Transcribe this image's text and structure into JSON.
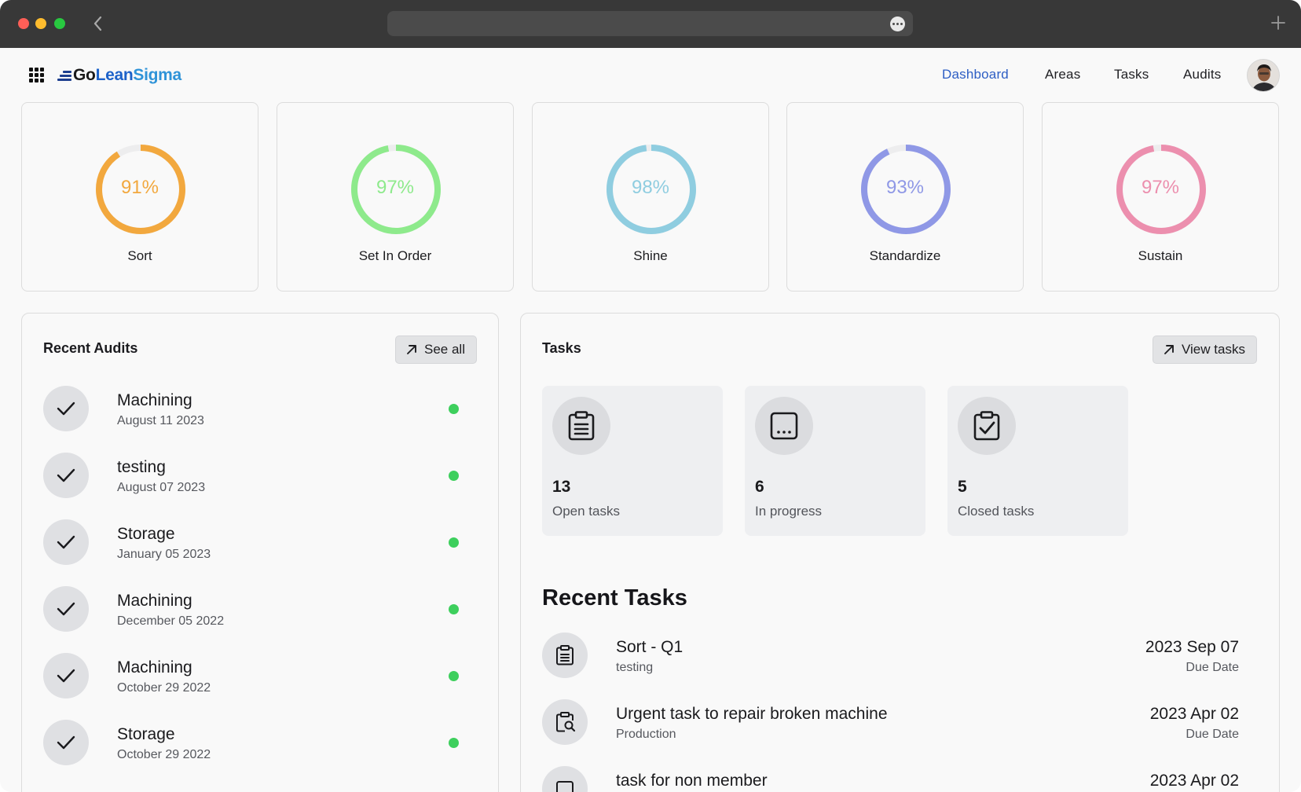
{
  "window": {
    "controls": [
      "close",
      "minimize",
      "zoom"
    ],
    "back_icon": "chevron-left-icon",
    "url_more_icon": "ellipsis-icon",
    "new_tab_icon": "plus-icon"
  },
  "header": {
    "app_grid_icon": "apps-grid-icon",
    "logo": {
      "go": "Go",
      "lean": "Lean",
      "sigma": "Sigma"
    },
    "nav": [
      {
        "label": "Dashboard",
        "active": true
      },
      {
        "label": "Areas",
        "active": false
      },
      {
        "label": "Tasks",
        "active": false
      },
      {
        "label": "Audits",
        "active": false
      }
    ],
    "avatar_icon": "user-avatar"
  },
  "scores": [
    {
      "name": "Sort",
      "value": 91,
      "label": "91%",
      "color": "#f2a83e"
    },
    {
      "name": "Set In Order",
      "value": 97,
      "label": "97%",
      "color": "#8eea8c"
    },
    {
      "name": "Shine",
      "value": 98,
      "label": "98%",
      "color": "#8fcde0"
    },
    {
      "name": "Standardize",
      "value": 93,
      "label": "93%",
      "color": "#8f98e6"
    },
    {
      "name": "Sustain",
      "value": 97,
      "label": "97%",
      "color": "#ec8fae"
    }
  ],
  "track_color": "#ededee",
  "recent_audits": {
    "title": "Recent Audits",
    "see_all_label": "See all",
    "items": [
      {
        "name": "Machining",
        "date": "August 11 2023"
      },
      {
        "name": "testing",
        "date": "August 07 2023"
      },
      {
        "name": "Storage",
        "date": "January 05 2023"
      },
      {
        "name": "Machining",
        "date": "December 05 2022"
      },
      {
        "name": "Machining",
        "date": "October 29 2022"
      },
      {
        "name": "Storage",
        "date": "October 29 2022"
      }
    ],
    "status_color": "#3ecf5d"
  },
  "tasks": {
    "title": "Tasks",
    "view_label": "View tasks",
    "stats": [
      {
        "count": "13",
        "label": "Open tasks",
        "icon": "clipboard-list-icon"
      },
      {
        "count": "6",
        "label": "In progress",
        "icon": "ellipsis-square-icon"
      },
      {
        "count": "5",
        "label": "Closed tasks",
        "icon": "clipboard-check-icon"
      }
    ],
    "recent_title": "Recent Tasks",
    "recent": [
      {
        "name": "Sort - Q1",
        "area": "testing",
        "date": "2023 Sep 07",
        "due_label": "Due Date",
        "icon": "clipboard-list-icon"
      },
      {
        "name": "Urgent task to repair broken machine",
        "area": "Production",
        "date": "2023 Apr 02",
        "due_label": "Due Date",
        "icon": "clipboard-search-icon"
      },
      {
        "name": "task for non member",
        "area": "",
        "date": "2023 Apr 02",
        "due_label": "",
        "icon": "square-icon"
      }
    ]
  }
}
